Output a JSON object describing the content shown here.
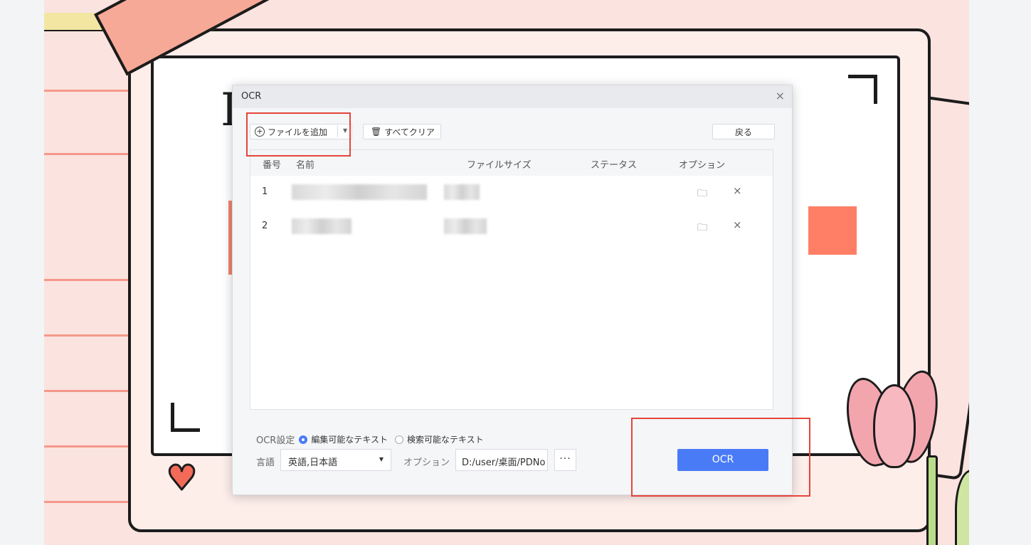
{
  "dialog": {
    "title": "OCR",
    "close_icon": "×",
    "toolbar": {
      "add_file_label": "ファイルを追加",
      "clear_all_label": "すべてクリア",
      "back_label": "戻る"
    },
    "table": {
      "headers": {
        "number": "番号",
        "name": "名前",
        "file_size": "ファイルサイズ",
        "status": "ステータス",
        "options": "オプション"
      },
      "rows": [
        {
          "number": "1"
        },
        {
          "number": "2"
        }
      ]
    },
    "settings": {
      "ocr_label": "OCR設定",
      "editable_text": "編集可能なテキスト",
      "searchable_text": "検索可能なテキスト",
      "selected": "editable_text"
    },
    "language": {
      "label": "言語",
      "value": "英語,日本語"
    },
    "options": {
      "label": "オプション",
      "path": "D:/user/桌面/PDNo",
      "more_label": "···"
    },
    "ocr_button_label": "OCR"
  },
  "colors": {
    "accent": "#4a7bf7",
    "annotation": "#e5453a"
  }
}
